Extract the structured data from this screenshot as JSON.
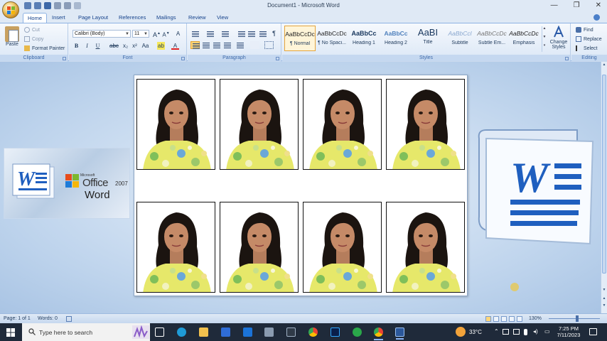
{
  "window": {
    "title": "Document1 - Microsoft Word",
    "controls": [
      "—",
      "❐",
      "✕"
    ]
  },
  "tabs": [
    "Home",
    "Insert",
    "Page Layout",
    "References",
    "Mailings",
    "Review",
    "View"
  ],
  "clipboard": {
    "paste": "Paste",
    "cut": "Cut",
    "copy": "Copy",
    "format_painter": "Format Painter",
    "label": "Clipboard"
  },
  "font": {
    "name": "Calibri (Body)",
    "size": "11",
    "bold": "B",
    "italic": "I",
    "underline": "U",
    "label": "Font"
  },
  "paragraph": {
    "label": "Paragraph"
  },
  "styles": {
    "items": [
      {
        "sample": "AaBbCcDc",
        "name": "¶ Normal"
      },
      {
        "sample": "AaBbCcDc",
        "name": "¶ No Spaci..."
      },
      {
        "sample": "AaBbCc",
        "name": "Heading 1"
      },
      {
        "sample": "AaBbCc",
        "name": "Heading 2"
      },
      {
        "sample": "AaBI",
        "name": "Title"
      },
      {
        "sample": "AaBbCcl",
        "name": "Subtitle"
      },
      {
        "sample": "AaBbCcDc",
        "name": "Subtle Em..."
      },
      {
        "sample": "AaBbCcDc",
        "name": "Emphasis"
      }
    ],
    "change_styles": "Change Styles",
    "label": "Styles"
  },
  "editing": {
    "find": "Find",
    "replace": "Replace",
    "select": "Select",
    "label": "Editing"
  },
  "promo": {
    "microsoft": "Microsoft",
    "office": "Office",
    "version": "2007",
    "word": "Word"
  },
  "status": {
    "page": "Page: 1 of 1",
    "words": "Words: 0",
    "zoom": "130%"
  },
  "taskbar": {
    "search_placeholder": "Type here to search",
    "weather": "33°C",
    "time": "7:25 PM",
    "date": "7/11/2023"
  },
  "colors": {
    "accent": "#2b579a",
    "ribbon": "#dbe7f6",
    "taskbar": "#1f2a3a"
  }
}
